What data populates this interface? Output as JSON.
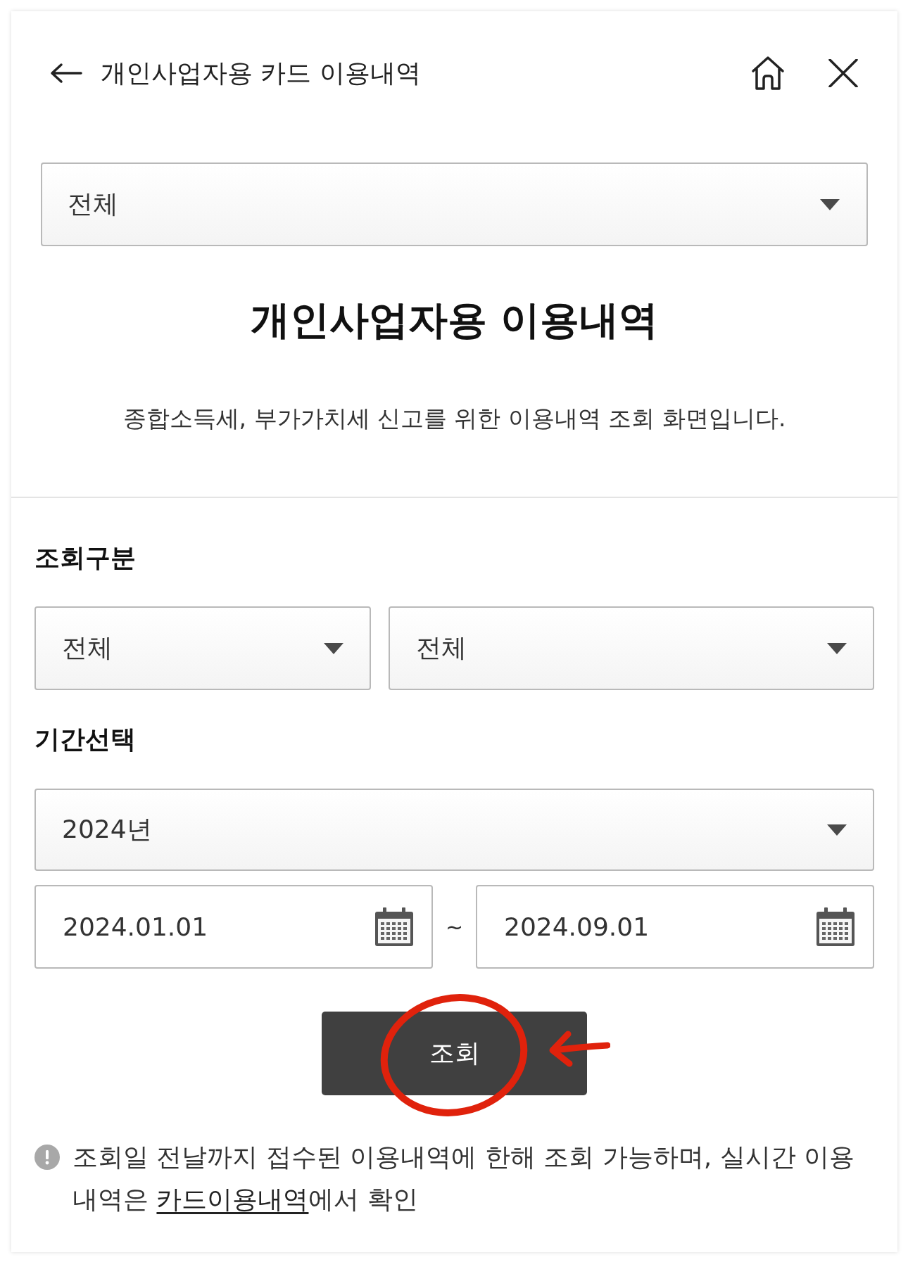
{
  "header": {
    "title": "개인사업자용 카드 이용내역"
  },
  "card_select": {
    "value": "전체"
  },
  "heading": "개인사업자용 이용내역",
  "description": "종합소득세, 부가가치세 신고를 위한 이용내역 조회 화면입니다.",
  "search_type": {
    "label": "조회구분",
    "selects": [
      {
        "value": "전체"
      },
      {
        "value": "전체"
      }
    ]
  },
  "period": {
    "label": "기간선택",
    "year_select": {
      "value": "2024년"
    },
    "start_date": {
      "value": "2024.01.01"
    },
    "separator": "~",
    "end_date": {
      "value": "2024.09.01"
    }
  },
  "search_button": {
    "label": "조회",
    "circled": true,
    "arrow_pointed": true
  },
  "notes": [
    {
      "before": "조회일 전날까지 접수된 이용내역에 한해 조회 가능하며, 실시간 이용내역은 ",
      "link": "카드이용내역",
      "after": "에서 확인"
    }
  ]
}
